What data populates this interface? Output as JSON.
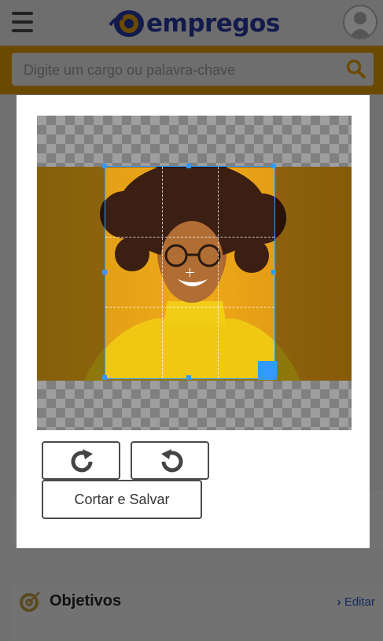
{
  "header": {
    "brand": "empregos",
    "menu_icon": "hamburger-icon",
    "profile_icon": "user-avatar-icon"
  },
  "search": {
    "placeholder": "Digite um cargo ou palavra-chave",
    "icon": "search-icon"
  },
  "section": {
    "title": "Objetivos",
    "edit_label": "Editar",
    "icon": "target-icon"
  },
  "crop_modal": {
    "rotate_right_icon": "rotate-clockwise-icon",
    "rotate_left_icon": "rotate-counterclockwise-icon",
    "save_label": "Cortar e Salvar"
  },
  "colors": {
    "accent": "#F2A300",
    "navy": "#121A4D",
    "cropper_blue": "#3399FF"
  }
}
